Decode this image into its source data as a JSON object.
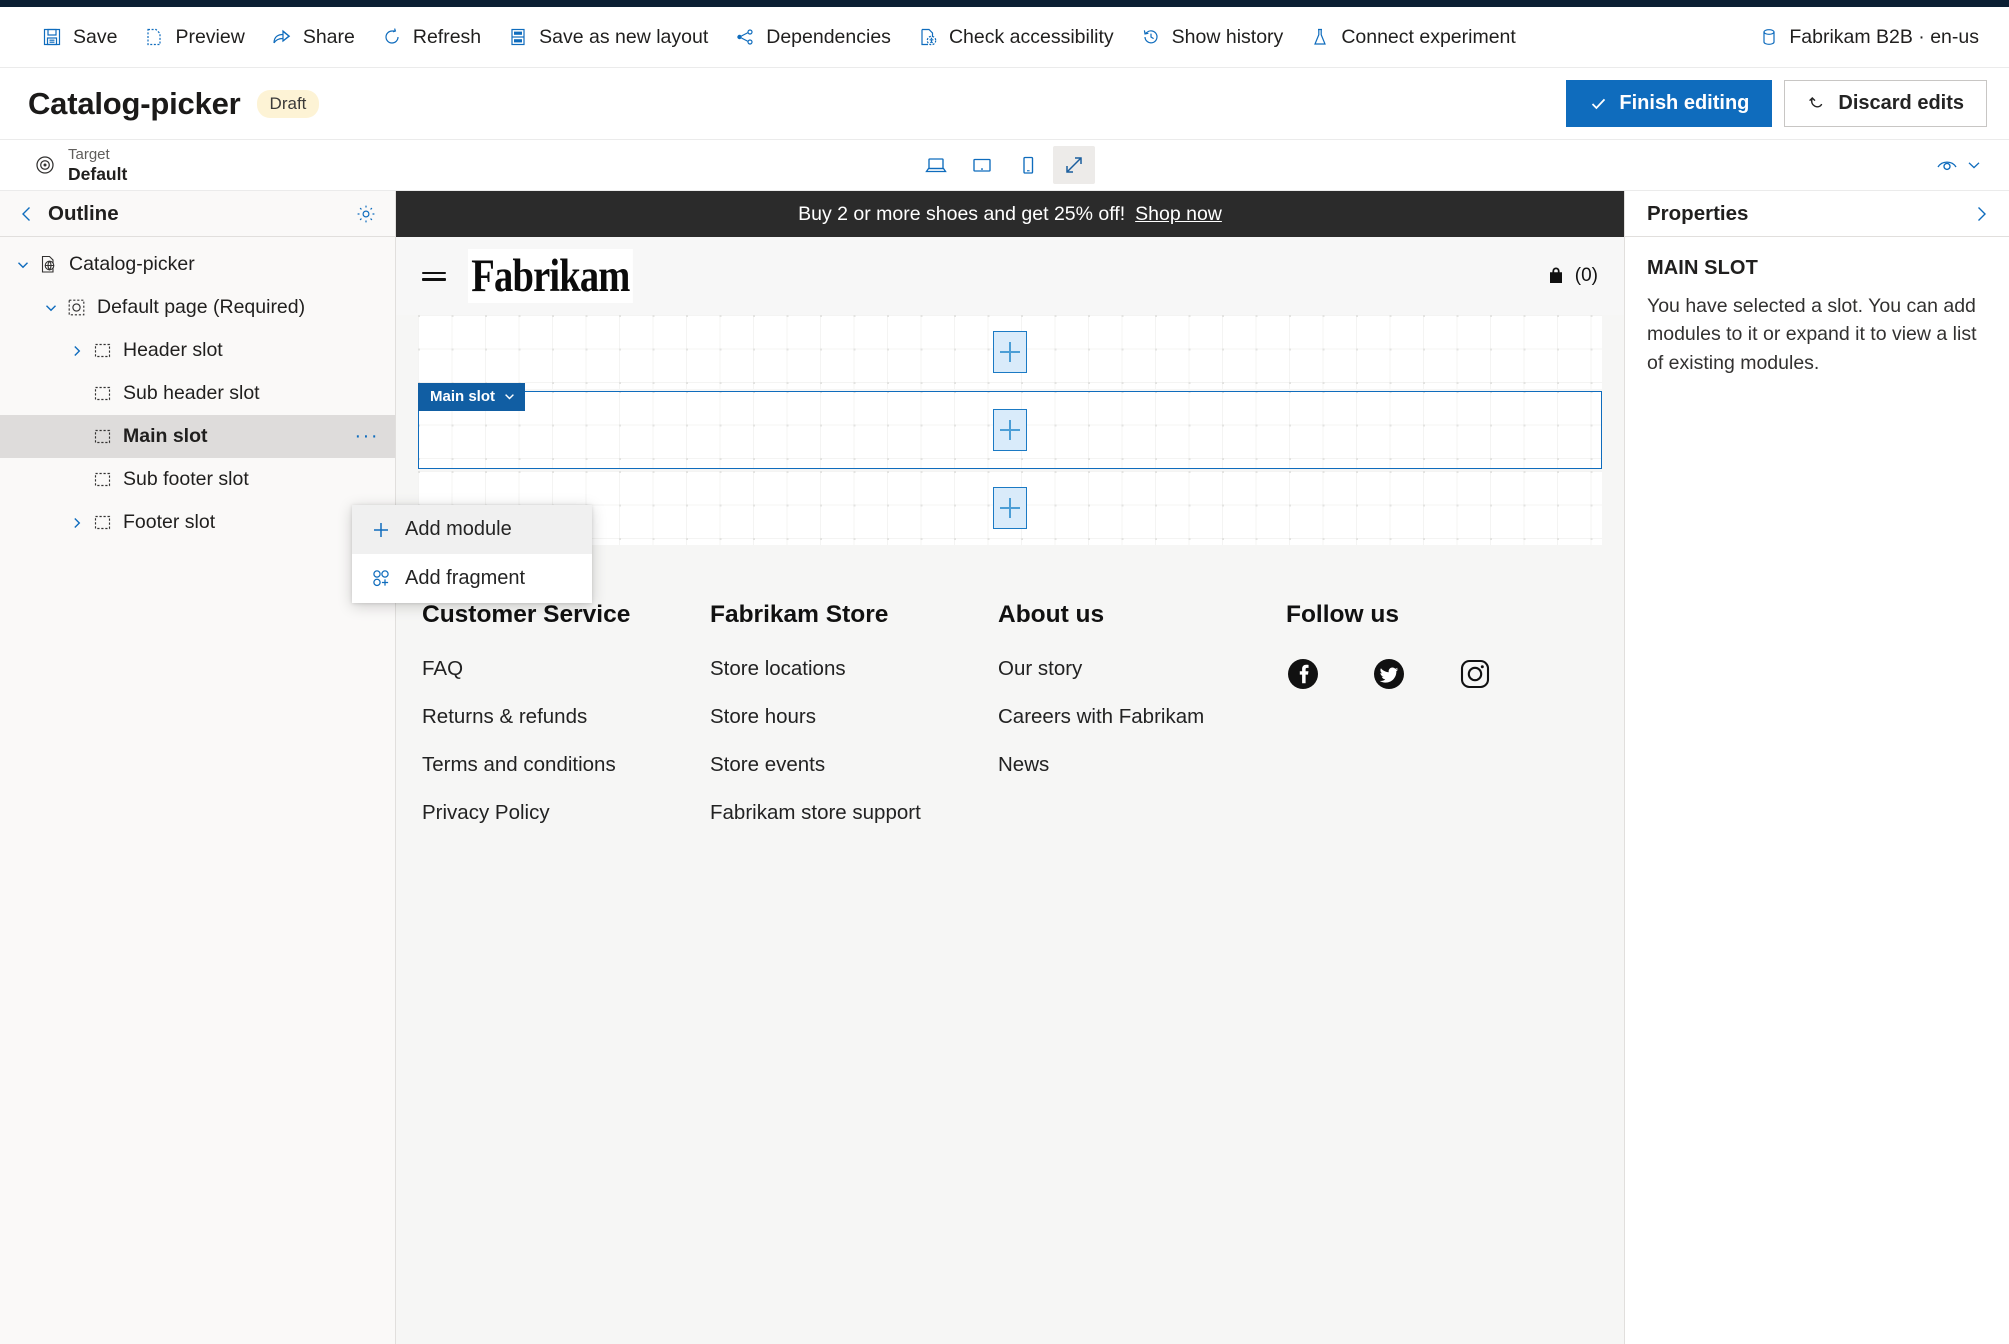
{
  "commandbar": {
    "items": [
      {
        "label": "Save",
        "icon": "save-icon"
      },
      {
        "label": "Preview",
        "icon": "preview-icon"
      },
      {
        "label": "Share",
        "icon": "share-icon"
      },
      {
        "label": "Refresh",
        "icon": "refresh-icon"
      },
      {
        "label": "Save as new layout",
        "icon": "layout-icon"
      },
      {
        "label": "Dependencies",
        "icon": "dependencies-icon"
      },
      {
        "label": "Check accessibility",
        "icon": "accessibility-icon"
      },
      {
        "label": "Show history",
        "icon": "history-icon"
      },
      {
        "label": "Connect experiment",
        "icon": "experiment-icon"
      }
    ],
    "environment": "Fabrikam B2B · en-us",
    "environment_icon": "database-icon"
  },
  "pageheader": {
    "title": "Catalog-picker",
    "status": "Draft",
    "finish_editing": "Finish editing",
    "discard_edits": "Discard edits"
  },
  "targetbar": {
    "target_label": "Target",
    "target_value": "Default",
    "devices": [
      {
        "name": "desktop-view",
        "active": false
      },
      {
        "name": "tablet-view",
        "active": false
      },
      {
        "name": "mobile-view",
        "active": false
      },
      {
        "name": "fullwidth-view",
        "active": true
      }
    ]
  },
  "outline": {
    "title": "Outline",
    "tree": [
      {
        "label": "Catalog-picker",
        "depth": 0,
        "chevron": "down",
        "icon": "page-globe-icon",
        "selected": false,
        "more": false
      },
      {
        "label": "Default page (Required)",
        "depth": 1,
        "chevron": "down",
        "icon": "page-slot-icon",
        "selected": false,
        "more": false
      },
      {
        "label": "Header slot",
        "depth": 2,
        "chevron": "right",
        "icon": "slot-icon",
        "selected": false,
        "more": false
      },
      {
        "label": "Sub header slot",
        "depth": 2,
        "chevron": "none",
        "icon": "slot-icon",
        "selected": false,
        "more": false
      },
      {
        "label": "Main slot",
        "depth": 2,
        "chevron": "none",
        "icon": "slot-icon",
        "selected": true,
        "more": true,
        "more_label": "···"
      },
      {
        "label": "Sub footer slot",
        "depth": 2,
        "chevron": "none",
        "icon": "slot-icon",
        "selected": false,
        "more": false
      },
      {
        "label": "Footer slot",
        "depth": 2,
        "chevron": "right",
        "icon": "slot-icon",
        "selected": false,
        "more": false
      }
    ]
  },
  "contextmenu": {
    "items": [
      {
        "label": "Add module",
        "icon": "plus-icon",
        "hovered": true
      },
      {
        "label": "Add fragment",
        "icon": "fragment-icon",
        "hovered": false
      }
    ]
  },
  "canvas": {
    "promo_text": "Buy 2 or more shoes and get 25% off!",
    "promo_link": "Shop now",
    "brand": "Fabrikam",
    "cart_count": "(0)",
    "slot_tag": "Main slot",
    "dropzones": [
      {
        "selected": false
      },
      {
        "selected": true
      },
      {
        "selected": false
      }
    ],
    "footer": {
      "columns": [
        {
          "heading": "Customer Service",
          "links": [
            "FAQ",
            "Returns & refunds",
            "Terms and conditions",
            "Privacy Policy"
          ]
        },
        {
          "heading": "Fabrikam Store",
          "links": [
            "Store locations",
            "Store hours",
            "Store events",
            "Fabrikam store support"
          ]
        },
        {
          "heading": "About us",
          "links": [
            "Our story",
            "Careers with Fabrikam",
            "News"
          ]
        }
      ],
      "follow_heading": "Follow us",
      "socials": [
        "facebook-icon",
        "twitter-icon",
        "instagram-icon"
      ]
    }
  },
  "properties": {
    "title": "Properties",
    "subtitle": "MAIN SLOT",
    "description": "You have selected a slot. You can add modules to it or expand it to view a list of existing modules."
  },
  "colors": {
    "accent": "#0f6cbd",
    "primary_button": "#0f6cbd",
    "draft_badge": "#fdf3d5",
    "promo_bar": "#2b2b2b",
    "selected_row": "#dedcdb"
  }
}
